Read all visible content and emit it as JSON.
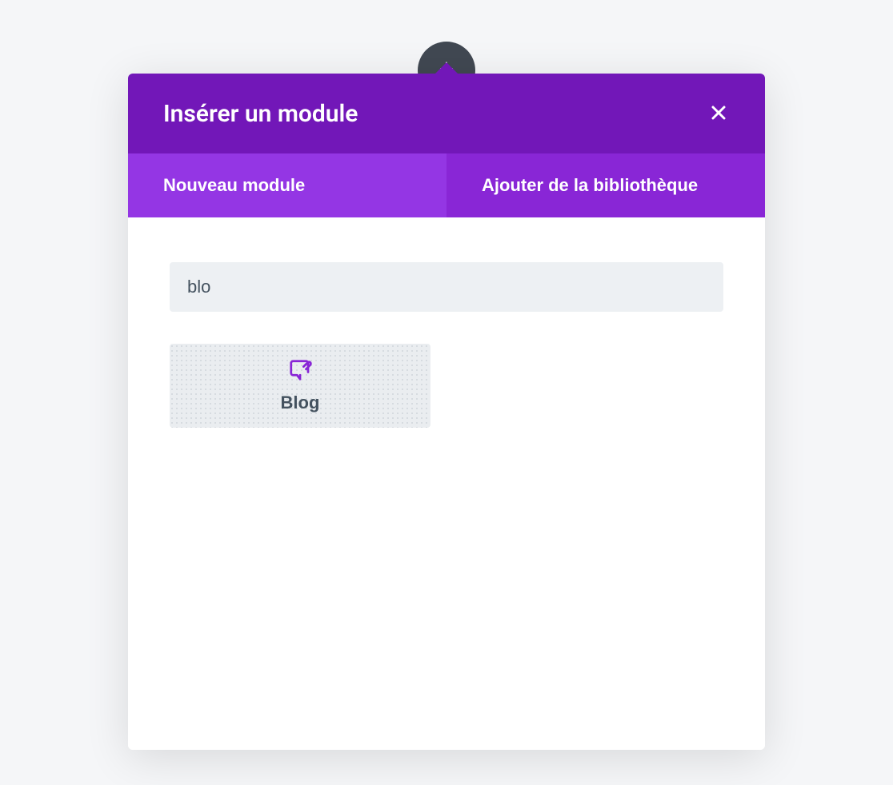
{
  "header": {
    "title": "Insérer un module"
  },
  "tabs": [
    {
      "label": "Nouveau module",
      "active": true
    },
    {
      "label": "Ajouter de la bibliothèque",
      "active": false
    }
  ],
  "search": {
    "value": "blo",
    "placeholder": ""
  },
  "modules": [
    {
      "icon": "blog-icon",
      "label": "Blog"
    }
  ],
  "colors": {
    "header": "#7217b8",
    "tabs_bg": "#8926d6",
    "tab_active": "#9436e4",
    "accent": "#8926d6",
    "add_circle": "#414852"
  }
}
